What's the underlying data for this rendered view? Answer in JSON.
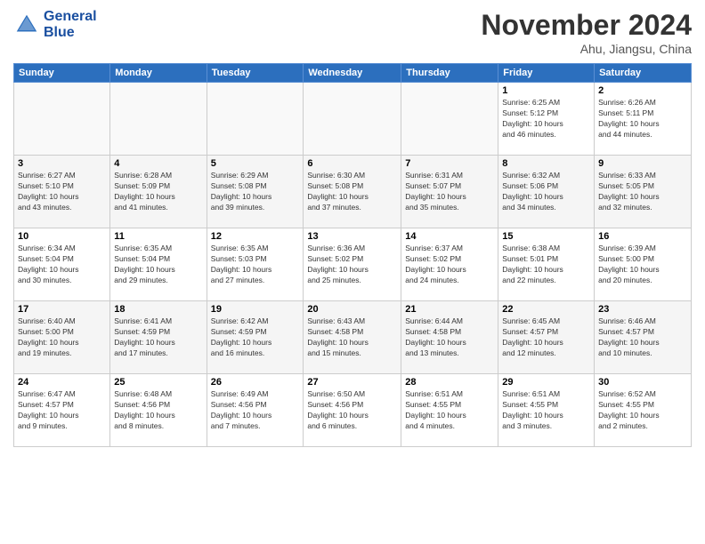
{
  "logo": {
    "line1": "General",
    "line2": "Blue"
  },
  "title": "November 2024",
  "location": "Ahu, Jiangsu, China",
  "weekdays": [
    "Sunday",
    "Monday",
    "Tuesday",
    "Wednesday",
    "Thursday",
    "Friday",
    "Saturday"
  ],
  "weeks": [
    [
      {
        "day": "",
        "info": ""
      },
      {
        "day": "",
        "info": ""
      },
      {
        "day": "",
        "info": ""
      },
      {
        "day": "",
        "info": ""
      },
      {
        "day": "",
        "info": ""
      },
      {
        "day": "1",
        "info": "Sunrise: 6:25 AM\nSunset: 5:12 PM\nDaylight: 10 hours\nand 46 minutes."
      },
      {
        "day": "2",
        "info": "Sunrise: 6:26 AM\nSunset: 5:11 PM\nDaylight: 10 hours\nand 44 minutes."
      }
    ],
    [
      {
        "day": "3",
        "info": "Sunrise: 6:27 AM\nSunset: 5:10 PM\nDaylight: 10 hours\nand 43 minutes."
      },
      {
        "day": "4",
        "info": "Sunrise: 6:28 AM\nSunset: 5:09 PM\nDaylight: 10 hours\nand 41 minutes."
      },
      {
        "day": "5",
        "info": "Sunrise: 6:29 AM\nSunset: 5:08 PM\nDaylight: 10 hours\nand 39 minutes."
      },
      {
        "day": "6",
        "info": "Sunrise: 6:30 AM\nSunset: 5:08 PM\nDaylight: 10 hours\nand 37 minutes."
      },
      {
        "day": "7",
        "info": "Sunrise: 6:31 AM\nSunset: 5:07 PM\nDaylight: 10 hours\nand 35 minutes."
      },
      {
        "day": "8",
        "info": "Sunrise: 6:32 AM\nSunset: 5:06 PM\nDaylight: 10 hours\nand 34 minutes."
      },
      {
        "day": "9",
        "info": "Sunrise: 6:33 AM\nSunset: 5:05 PM\nDaylight: 10 hours\nand 32 minutes."
      }
    ],
    [
      {
        "day": "10",
        "info": "Sunrise: 6:34 AM\nSunset: 5:04 PM\nDaylight: 10 hours\nand 30 minutes."
      },
      {
        "day": "11",
        "info": "Sunrise: 6:35 AM\nSunset: 5:04 PM\nDaylight: 10 hours\nand 29 minutes."
      },
      {
        "day": "12",
        "info": "Sunrise: 6:35 AM\nSunset: 5:03 PM\nDaylight: 10 hours\nand 27 minutes."
      },
      {
        "day": "13",
        "info": "Sunrise: 6:36 AM\nSunset: 5:02 PM\nDaylight: 10 hours\nand 25 minutes."
      },
      {
        "day": "14",
        "info": "Sunrise: 6:37 AM\nSunset: 5:02 PM\nDaylight: 10 hours\nand 24 minutes."
      },
      {
        "day": "15",
        "info": "Sunrise: 6:38 AM\nSunset: 5:01 PM\nDaylight: 10 hours\nand 22 minutes."
      },
      {
        "day": "16",
        "info": "Sunrise: 6:39 AM\nSunset: 5:00 PM\nDaylight: 10 hours\nand 20 minutes."
      }
    ],
    [
      {
        "day": "17",
        "info": "Sunrise: 6:40 AM\nSunset: 5:00 PM\nDaylight: 10 hours\nand 19 minutes."
      },
      {
        "day": "18",
        "info": "Sunrise: 6:41 AM\nSunset: 4:59 PM\nDaylight: 10 hours\nand 17 minutes."
      },
      {
        "day": "19",
        "info": "Sunrise: 6:42 AM\nSunset: 4:59 PM\nDaylight: 10 hours\nand 16 minutes."
      },
      {
        "day": "20",
        "info": "Sunrise: 6:43 AM\nSunset: 4:58 PM\nDaylight: 10 hours\nand 15 minutes."
      },
      {
        "day": "21",
        "info": "Sunrise: 6:44 AM\nSunset: 4:58 PM\nDaylight: 10 hours\nand 13 minutes."
      },
      {
        "day": "22",
        "info": "Sunrise: 6:45 AM\nSunset: 4:57 PM\nDaylight: 10 hours\nand 12 minutes."
      },
      {
        "day": "23",
        "info": "Sunrise: 6:46 AM\nSunset: 4:57 PM\nDaylight: 10 hours\nand 10 minutes."
      }
    ],
    [
      {
        "day": "24",
        "info": "Sunrise: 6:47 AM\nSunset: 4:57 PM\nDaylight: 10 hours\nand 9 minutes."
      },
      {
        "day": "25",
        "info": "Sunrise: 6:48 AM\nSunset: 4:56 PM\nDaylight: 10 hours\nand 8 minutes."
      },
      {
        "day": "26",
        "info": "Sunrise: 6:49 AM\nSunset: 4:56 PM\nDaylight: 10 hours\nand 7 minutes."
      },
      {
        "day": "27",
        "info": "Sunrise: 6:50 AM\nSunset: 4:56 PM\nDaylight: 10 hours\nand 6 minutes."
      },
      {
        "day": "28",
        "info": "Sunrise: 6:51 AM\nSunset: 4:55 PM\nDaylight: 10 hours\nand 4 minutes."
      },
      {
        "day": "29",
        "info": "Sunrise: 6:51 AM\nSunset: 4:55 PM\nDaylight: 10 hours\nand 3 minutes."
      },
      {
        "day": "30",
        "info": "Sunrise: 6:52 AM\nSunset: 4:55 PM\nDaylight: 10 hours\nand 2 minutes."
      }
    ]
  ]
}
